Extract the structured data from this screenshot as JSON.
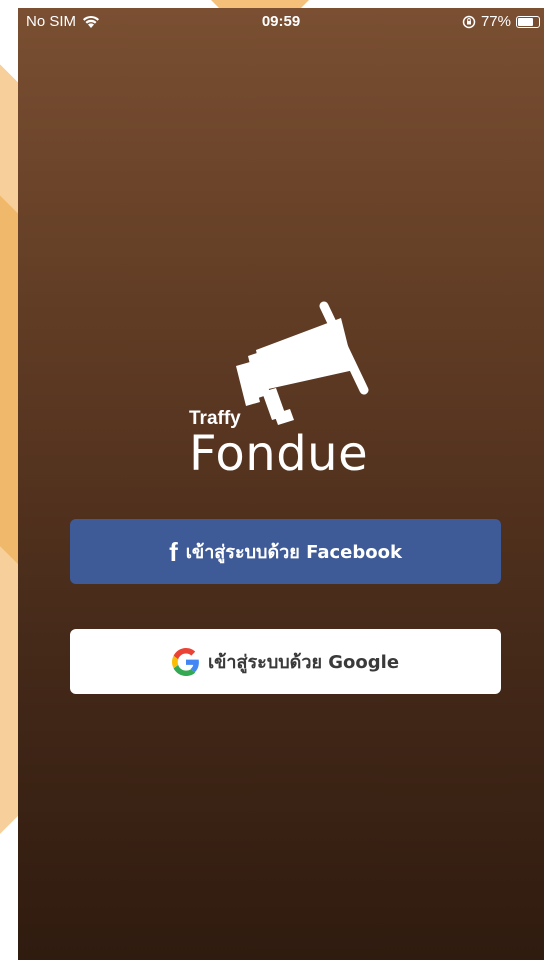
{
  "status_bar": {
    "carrier": "No SIM",
    "time": "09:59",
    "battery": "77%",
    "battery_level": 0.77
  },
  "brand": {
    "line1": "Traffy",
    "line2": "Fondue"
  },
  "login": {
    "facebook_label": "เข้าสู่ระบบด้วย Facebook",
    "google_label": "เข้าสู่ระบบด้วย Google"
  },
  "colors": {
    "facebook_blue": "#3e5a97",
    "background_top": "#7a4f32",
    "background_bottom": "#2f1b0f",
    "accent_orange": "#f0b86a"
  },
  "icons": [
    "wifi-icon",
    "orientation-lock-icon",
    "battery-icon",
    "megaphone-icon",
    "facebook-icon",
    "google-icon"
  ]
}
